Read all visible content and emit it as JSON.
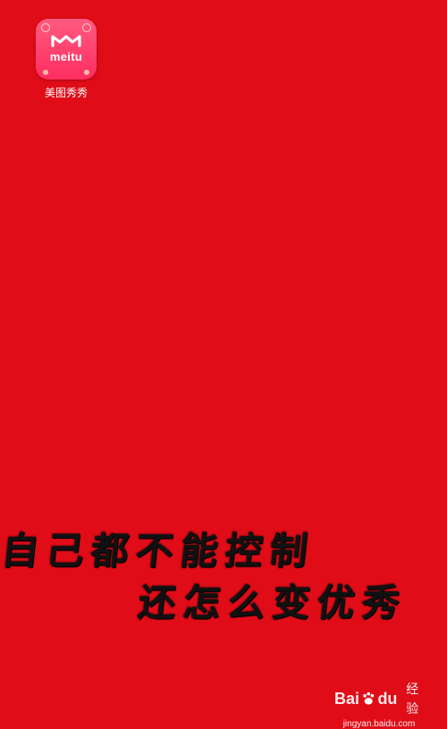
{
  "app": {
    "brand_text": "meitu",
    "label": "美图秀秀"
  },
  "slogan": {
    "line1": "自己都不能控制",
    "line2": "还怎么变优秀"
  },
  "watermark": {
    "brand_prefix": "Bai",
    "brand_suffix": "du",
    "brand_cn": "经验",
    "url": "jingyan.baidu.com"
  },
  "colors": {
    "background": "#e00c18",
    "icon_gradient_top": "#ff5a80",
    "icon_gradient_bottom": "#ff2d62",
    "slogan_text": "#111111"
  }
}
